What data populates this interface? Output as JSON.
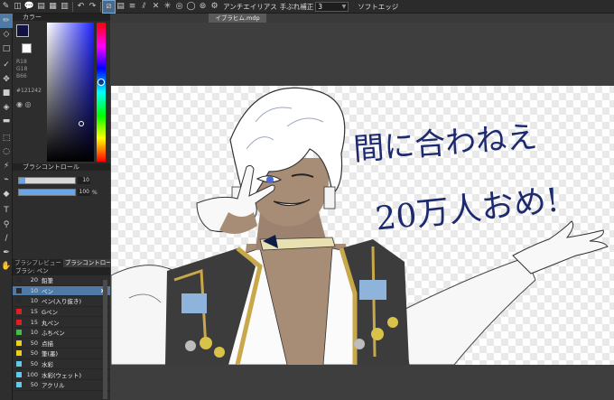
{
  "topbar": {
    "antialias_label": "アンチエイリアス",
    "stabilize_label": "手ぶれ補正",
    "stabilize_value": "3",
    "soft_label": "ソフトエッジ"
  },
  "document": {
    "tab_title": "イブラヒム.mdp"
  },
  "color_panel": {
    "title": "カラー",
    "main_color": "#121242",
    "r": "R18",
    "g": "G18",
    "b": "B66",
    "hex": "#121242"
  },
  "brush_control": {
    "title": "ブラシコントロール",
    "size_value": "10",
    "opacity_value": "100",
    "opacity_unit": "%",
    "size_fraction": 0.12,
    "opacity_fraction": 1.0
  },
  "preview_tabs": {
    "tab1": "ブラシプレビュー",
    "tab2": "ブラシコントロール"
  },
  "brush_list": {
    "title": "ブラシ: ペン",
    "items": [
      {
        "size": "20",
        "name": "鉛筆",
        "color": "#2a2a2a"
      },
      {
        "size": "10",
        "name": "ペン",
        "color": "#2a2a2a"
      },
      {
        "size": "10",
        "name": "ペン(入り抜き)",
        "color": "#2a2a2a"
      },
      {
        "size": "15",
        "name": "Gペン",
        "color": "#e02020"
      },
      {
        "size": "15",
        "name": "丸ペン",
        "color": "#e02020"
      },
      {
        "size": "10",
        "name": "ふちペン",
        "color": "#40c040"
      },
      {
        "size": "50",
        "name": "点描",
        "color": "#e8d020"
      },
      {
        "size": "50",
        "name": "筆(墨)",
        "color": "#e8d020"
      },
      {
        "size": "50",
        "name": "水彩",
        "color": "#60c8e8"
      },
      {
        "size": "100",
        "name": "水彩(ウェット)",
        "color": "#60c8e8"
      },
      {
        "size": "50",
        "name": "アクリル",
        "color": "#60c8e8"
      }
    ]
  },
  "canvas": {
    "handwriting_line1": "間に合わねえ",
    "handwriting_line2": "20万人おめ!"
  }
}
